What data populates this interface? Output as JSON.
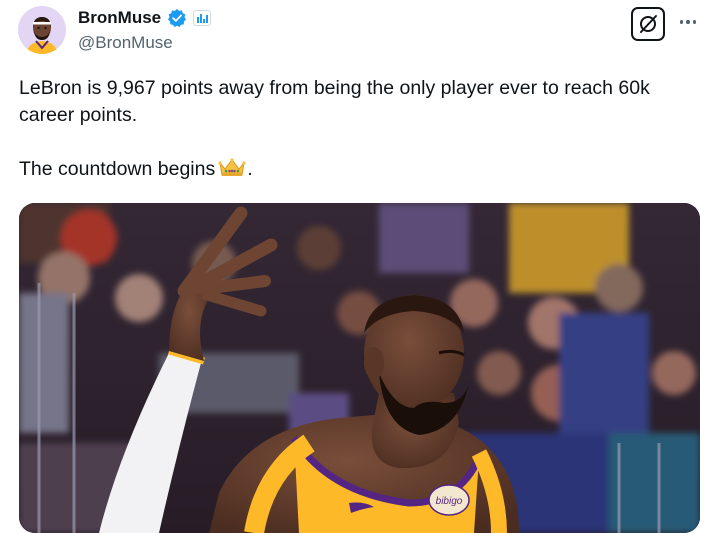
{
  "author": {
    "display_name": "BronMuse",
    "handle": "@BronMuse",
    "verified": true,
    "avatar_icon": "lebron-avatar-icon"
  },
  "icons": {
    "verified": "verified-badge-icon",
    "affiliate": "affiliate-badge-icon",
    "grok": "grok-icon",
    "more": "more-options-icon",
    "crown": "crown-emoji-icon"
  },
  "tweet": {
    "line1": "LeBron is 9,967 points away from being the only player ever to reach 60k career points.",
    "line2_text": "The countdown begins",
    "line2_suffix": "."
  },
  "media": {
    "jersey_sponsor": "bibigo"
  },
  "colors": {
    "verified_blue": "#1d9bf0",
    "text_primary": "#0f1419",
    "text_secondary": "#536471",
    "lakers_gold": "#fdb927",
    "lakers_purple": "#552583"
  }
}
